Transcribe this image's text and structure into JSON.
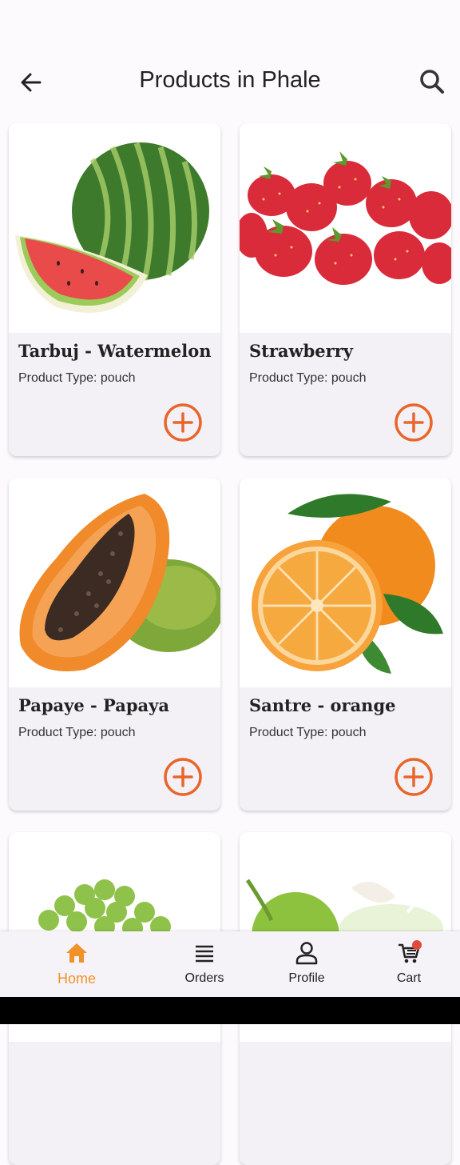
{
  "header": {
    "title": "Products in Phale"
  },
  "products": [
    {
      "name": "Tarbuj - Watermelon",
      "type": "Product Type: pouch"
    },
    {
      "name": "Strawberry",
      "type": "Product Type: pouch"
    },
    {
      "name": "Papaye - Papaya",
      "type": "Product Type: pouch"
    },
    {
      "name": "Santre - orange",
      "type": "Product Type: pouch"
    },
    {
      "name": "",
      "type": ""
    },
    {
      "name": "",
      "type": ""
    }
  ],
  "bottom_nav": {
    "items": [
      {
        "label": "Home",
        "icon": "home-icon",
        "active": true
      },
      {
        "label": "Orders",
        "icon": "list-icon",
        "active": false
      },
      {
        "label": "Profile",
        "icon": "person-icon",
        "active": false
      },
      {
        "label": "Cart",
        "icon": "cart-icon",
        "active": false,
        "badge": true
      }
    ]
  },
  "colors": {
    "accent": "#e8662a",
    "active_nav": "#f0922a",
    "badge": "#e04a3a",
    "card_bg": "#f4f1f6"
  }
}
